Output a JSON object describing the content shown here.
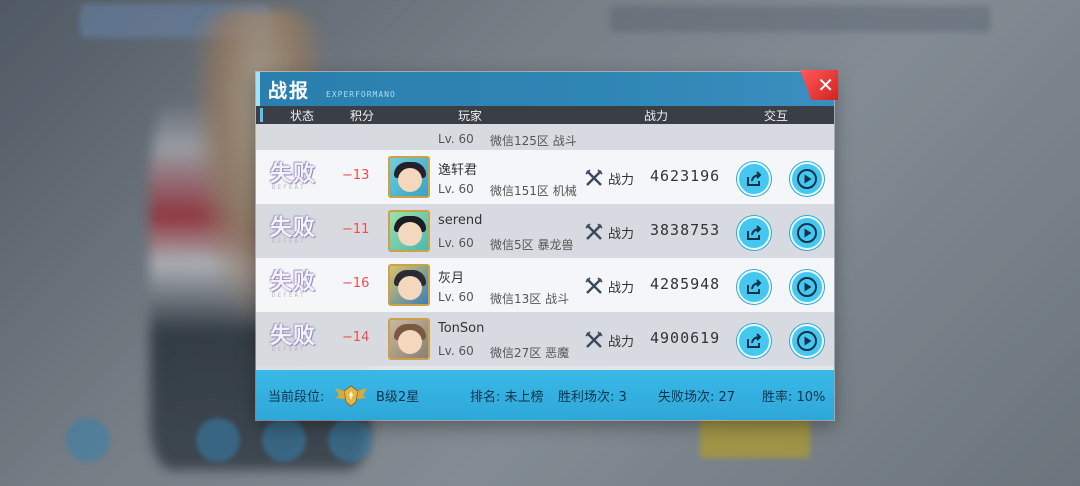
{
  "dialog": {
    "title": "战报",
    "subtitle": "EXPERFORMANO",
    "close_label": "✕"
  },
  "columns": {
    "status": "状态",
    "score": "积分",
    "player": "玩家",
    "power": "战力",
    "interact": "交互"
  },
  "partial_row": {
    "level": "Lv. 60",
    "server": "微信125区 战斗"
  },
  "rows": [
    {
      "status": "失败",
      "status_sub": "DEFEAT",
      "score": "−13",
      "name": "逸轩君",
      "level": "Lv. 60",
      "server": "微信151区 机械",
      "power_label": "战力",
      "power": "4623196"
    },
    {
      "status": "失败",
      "status_sub": "DEFEAT",
      "score": "−11",
      "name": "serend",
      "level": "Lv. 60",
      "server": "微信5区 暴龙兽",
      "power_label": "战力",
      "power": "3838753"
    },
    {
      "status": "失败",
      "status_sub": "DEFEAT",
      "score": "−16",
      "name": "灰月",
      "level": "Lv. 60",
      "server": "微信13区 战斗",
      "power_label": "战力",
      "power": "4285948"
    },
    {
      "status": "失败",
      "status_sub": "DEFEAT",
      "score": "−14",
      "name": "TonSon",
      "level": "Lv. 60",
      "server": "微信27区 恶魔",
      "power_label": "战力",
      "power": "4900619"
    }
  ],
  "footer": {
    "rank_label": "当前段位:",
    "rank_value": "B级2星",
    "ranking": "排名: 未上榜",
    "wins": "胜利场次: 3",
    "losses": "失败场次: 27",
    "win_rate": "胜率: 10%"
  },
  "colors": {
    "accent": "#45c8f0",
    "title_bar": "#2e86b5",
    "score_negative": "#f04c4c",
    "footer": "#36b3e3",
    "close": "#e02b2b"
  },
  "icons": {
    "close": "close-icon",
    "share": "share-icon",
    "play": "play-replay-icon",
    "power": "crossed-swords-icon",
    "rank": "rank-wings-emblem-icon"
  }
}
